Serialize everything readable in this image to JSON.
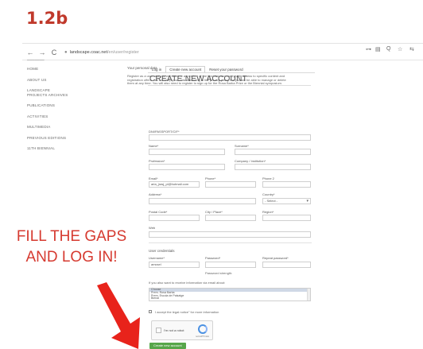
{
  "slide": {
    "title": "1.2b",
    "fill_line1": "FILL THE GAPS",
    "fill_line2": "AND LOG IN!"
  },
  "browser": {
    "nav_back": "←",
    "nav_forward": "→",
    "reload": "C",
    "url_host": "landscape.coac.net",
    "url_path": "/en/user/register",
    "ext_icons": [
      "⊶",
      "▤",
      "Q",
      "☆",
      "⇆"
    ]
  },
  "sidebar": {
    "items": [
      "HOME",
      "ABOUT US",
      "LANDSCAPE PROJECTS ARCHIVES",
      "PUBLICATIONS",
      "ACTIVITIES",
      "MULTIMEDIA",
      "PREVIOUS EDITIONS",
      "11TH BIENNIAL"
    ]
  },
  "tabs": [
    "Log in",
    "Create new account",
    "Reset your password"
  ],
  "page_title": "CREATE NEW ACCOUNT",
  "personal": {
    "heading": "Your personal data",
    "intro": "Register as a user and you will become a member of the biennial community with access to specific content and registration offers. We will keep your data according to the privacy policy but you will be able to manage or delete them at any time. You will also need to register to sign up for the Rosa Barba Prize or the Biennial symposium."
  },
  "form": {
    "dni_label": "DNI/PASSPORT/CIF*",
    "name_label": "Name*",
    "surname_label": "Surname*",
    "profession_label": "Profession*",
    "company_label": "Company / Institution*",
    "email_label": "Email*",
    "email_value": "aria_jrasj_pl@hotmail.com",
    "phone_label": "Phone*",
    "phone2_label": "Phone 2",
    "address_label": "Address*",
    "country_label": "Country*",
    "country_value": "- Select -",
    "postal_label": "Postal Code*",
    "city_label": "City / Place*",
    "region_label": "Region*",
    "web_label": "Web"
  },
  "credentials": {
    "heading": "User credentials",
    "username_label": "Username*",
    "username_value": "amcsel",
    "password_label": "Password*",
    "repeat_label": "Repeat password*",
    "strength_label": "Password strength:"
  },
  "newsletter": {
    "prompt": "If you also want to receive information via email about:",
    "options": [
      "Choose",
      "Prem. Rosa Barba",
      "Prem. Escola de Paisatge",
      "Bienal"
    ]
  },
  "legal": {
    "text": "I accept the legal notice\" for more information"
  },
  "captcha": {
    "label": "I'm not a robot",
    "small": "reCAPTCHA"
  },
  "submit_label": "Create new account",
  "colors": {
    "accent_red": "#c0392b",
    "submit_green": "#57a64a"
  }
}
